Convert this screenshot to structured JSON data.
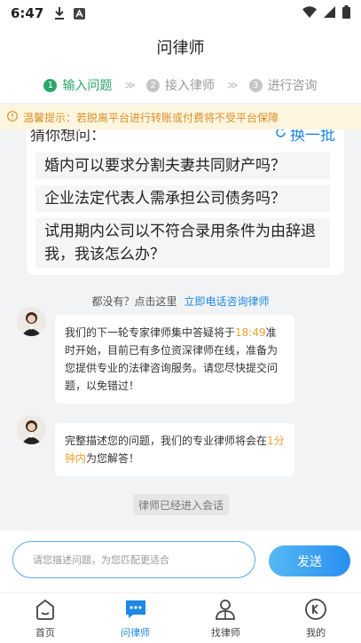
{
  "status_bar": {
    "time": "6:47"
  },
  "header": {
    "title": "问律师"
  },
  "steps": [
    {
      "num": "1",
      "label": "输入问题"
    },
    {
      "num": "2",
      "label": "接入律师"
    },
    {
      "num": "3",
      "label": "进行咨询"
    }
  ],
  "step_separator": "≫",
  "notice": {
    "text": "温馨提示：若脱离平台进行转账或付费将不受平台保障"
  },
  "guess": {
    "title": "猜你想问：",
    "refresh_label": "换一批",
    "questions": [
      "婚内可以要求分割夫妻共同财产吗？",
      "企业法定代表人需承担公司债务吗？",
      "试用期内公司以不符合录用条件为由辞退我，我该怎么办？"
    ]
  },
  "nobody": {
    "text": "都没有？点击这里",
    "link": "立即电话咨询律师"
  },
  "messages": [
    {
      "before": "我们的下一轮专家律师集中答疑将于",
      "highlight": "18:49",
      "after": "准时开始，目前已有多位资深律师在线，准备为您提供专业的法律咨询服务。请您尽快提交问题，以免错过！"
    },
    {
      "before": "完整描述您的问题，我们的专业律师将会在",
      "highlight": "1分钟内",
      "after": "为您解答！"
    }
  ],
  "system_tip": "律师已经进入会话",
  "input": {
    "placeholder": "请您描述问题，为您匹配更适合",
    "send_label": "发送"
  },
  "tabbar": [
    {
      "label": "首页",
      "icon": "home-icon"
    },
    {
      "label": "问律师",
      "icon": "chat-icon"
    },
    {
      "label": "找律师",
      "icon": "lawyer-icon"
    },
    {
      "label": "我的",
      "icon": "profile-icon"
    }
  ],
  "colors": {
    "accent": "#1e88e5",
    "step_active": "#2aa66a",
    "highlight": "#f0a030",
    "notice_bg": "#fff6e0",
    "notice_text": "#d9902a"
  }
}
